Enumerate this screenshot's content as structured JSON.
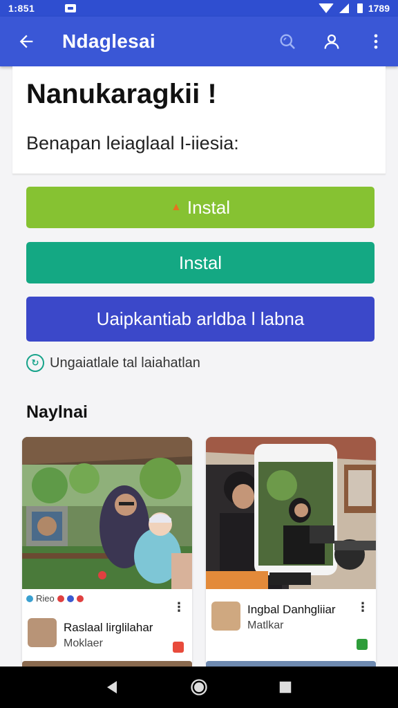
{
  "status_bar": {
    "time": "1:851",
    "right_text": "1789"
  },
  "app_bar": {
    "title": "Ndaglesai",
    "icons": [
      "back-arrow-icon",
      "search-icon",
      "account-icon",
      "more-vert-icon"
    ],
    "color": "#3a57d6"
  },
  "header": {
    "title": "Nanukaragkii !",
    "subtitle": "Benapan leiaglaal I-iiesia:"
  },
  "buttons": {
    "primary": {
      "label": "Instal",
      "color": "#86c232",
      "icon": "download-icon"
    },
    "secondary": {
      "label": "Instal",
      "color": "#14a883"
    },
    "tertiary": {
      "label": "Uaipkantiab arldba l labna",
      "color": "#3b48c9"
    }
  },
  "info": {
    "text": "Ungaiatlale tal laiahatlan",
    "icon": "refresh-info-icon"
  },
  "section": {
    "title": "Naylnai"
  },
  "cards": [
    {
      "tag_text": "Rieo",
      "app_name": "Raslaal lirglilahar",
      "app_sub": "Moklaer",
      "badge_color": "#e84b3c"
    },
    {
      "app_name": "Ingbal Danhgliiar",
      "app_sub": "Matlkar",
      "badge_color": "#2e9d3a"
    }
  ]
}
